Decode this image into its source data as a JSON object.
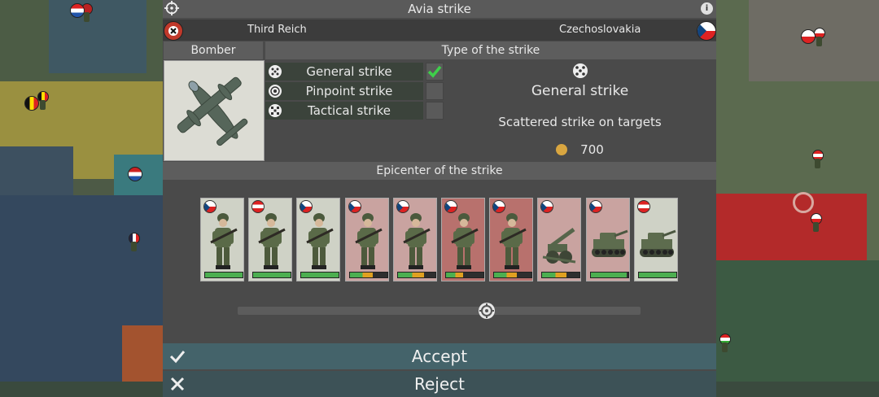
{
  "window": {
    "title": "Avia strike"
  },
  "sides": {
    "attacker": {
      "name": "Third Reich",
      "flag": "war-ensign"
    },
    "defender": {
      "name": "Czechoslovakia",
      "flag": "czechoslovakia-flag"
    }
  },
  "bomber": {
    "header": "Bomber",
    "icon": "bomber-plane-icon"
  },
  "strike_types": {
    "header": "Type of the strike",
    "options": [
      {
        "label": "General strike",
        "icon": "scatter-target-icon",
        "checked": true
      },
      {
        "label": "Pinpoint strike",
        "icon": "pinpoint-target-icon",
        "checked": false
      },
      {
        "label": "Tactical strike",
        "icon": "tactical-grid-icon",
        "checked": false
      }
    ],
    "selected": {
      "title": "General strike",
      "description": "Scattered strike on targets",
      "cost": "700",
      "cost_icon": "coin-icon"
    }
  },
  "epicenter": {
    "header": "Epicenter of the strike",
    "units": [
      {
        "flag": "czechoslovakia",
        "type": "infantry",
        "health": 1.0,
        "highlight": "none"
      },
      {
        "flag": "austria",
        "type": "infantry",
        "health": 1.0,
        "highlight": "none"
      },
      {
        "flag": "czechoslovakia",
        "type": "infantry",
        "health": 1.0,
        "highlight": "none"
      },
      {
        "flag": "czechoslovakia",
        "type": "infantry",
        "health": 0.6,
        "highlight": "light"
      },
      {
        "flag": "czechoslovakia",
        "type": "infantry",
        "health": 0.7,
        "highlight": "light"
      },
      {
        "flag": "czechoslovakia",
        "type": "infantry",
        "health": 0.45,
        "highlight": "strong"
      },
      {
        "flag": "czechoslovakia",
        "type": "infantry",
        "health": 0.6,
        "highlight": "strong"
      },
      {
        "flag": "czechoslovakia",
        "type": "artillery",
        "health": 0.65,
        "highlight": "light"
      },
      {
        "flag": "czechoslovakia",
        "type": "tank",
        "health": 0.95,
        "highlight": "light"
      },
      {
        "flag": "austria",
        "type": "tank",
        "health": 1.0,
        "highlight": "none"
      }
    ],
    "slider_value": 0.62
  },
  "buttons": {
    "accept": "Accept",
    "reject": "Reject"
  },
  "colors": {
    "panel": "#4a4a4a",
    "button": "#44636a",
    "health_full": "#4caf50",
    "health_mid": "#e0a020",
    "highlight_light": "#c9a3a0",
    "highlight_strong": "#b8716d",
    "check": "#3ecf4a"
  }
}
